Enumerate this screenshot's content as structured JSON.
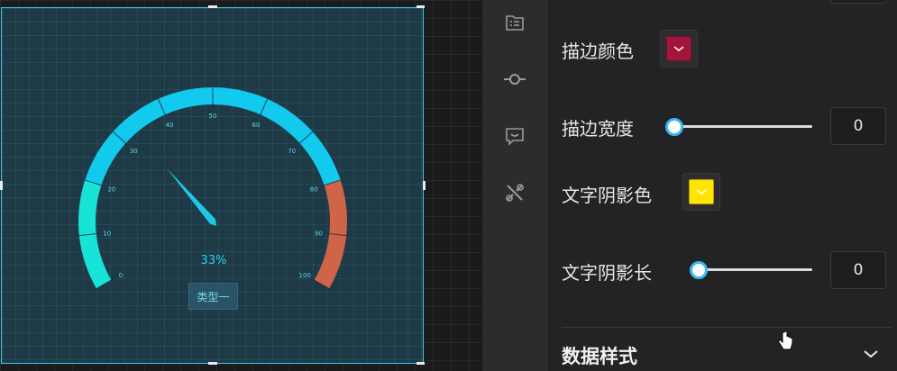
{
  "gauge": {
    "value_label": "33%",
    "type_button_label": "类型一",
    "tick_labels": [
      "0",
      "10",
      "20",
      "30",
      "40",
      "50",
      "60",
      "70",
      "80",
      "90",
      "100"
    ],
    "value_percent": 33,
    "colors": {
      "low": "#17e3d6",
      "mid": "#12c9ee",
      "high": "#cf6449",
      "pointer": "#1dc8e6"
    }
  },
  "rail": {
    "icons": [
      "list-icon",
      "commit-icon",
      "comment-icon",
      "tools-icon"
    ]
  },
  "panel": {
    "stroke_color_label": "描边颜色",
    "stroke_color": "#a3163c",
    "stroke_width_label": "描边宽度",
    "stroke_width_value": "0",
    "text_shadow_color_label": "文字阴影色",
    "text_shadow_color": "#ffe500",
    "text_shadow_length_label": "文字阴影长",
    "text_shadow_length_value": "0",
    "data_style_label": "数据样式"
  }
}
